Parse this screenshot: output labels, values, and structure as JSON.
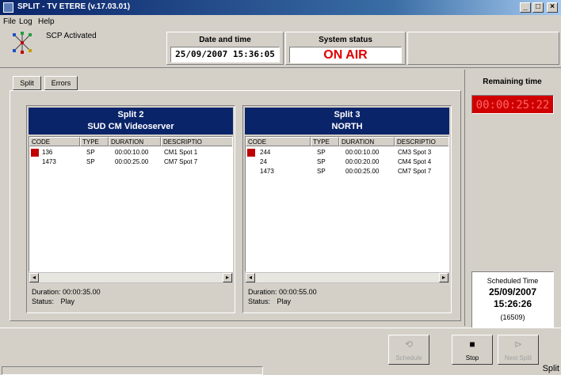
{
  "window": {
    "title": "SPLIT - TV ETERE (v.17.03.01)",
    "minimize": "_",
    "maximize": "□",
    "close": "×"
  },
  "menu": [
    "File",
    "Log",
    "Help"
  ],
  "header": {
    "scp_label": "SCP Activated",
    "datetime_label": "Date and time",
    "datetime_value": "25/09/2007   15:36:05",
    "status_label": "System status",
    "status_value": "ON AIR"
  },
  "tabs": [
    "Split",
    "Errors"
  ],
  "columns": [
    "CODE",
    "TYPE",
    "DURATION",
    "DESCRIPTIO"
  ],
  "splits": [
    {
      "title": "Split 2",
      "subtitle": "SUD CM Videoserver",
      "rows": [
        {
          "code": "136",
          "type": "SP",
          "duration": "00:00:10.00",
          "description": "CM1 Spot 1"
        },
        {
          "code": "1473",
          "type": "SP",
          "duration": "00:00:25.00",
          "description": "CM7 Spot 7"
        }
      ],
      "duration_label": "Duration:",
      "duration_value": "00:00:35.00",
      "status_label": "Status:",
      "status_value": "Play"
    },
    {
      "title": "Split 3",
      "subtitle": "NORTH",
      "rows": [
        {
          "code": "244",
          "type": "SP",
          "duration": "00:00:10.00",
          "description": "CM3 Spot 3"
        },
        {
          "code": "24",
          "type": "SP",
          "duration": "00:00:20.00",
          "description": "CM4 Spot 4"
        },
        {
          "code": "1473",
          "type": "SP",
          "duration": "00:00:25.00",
          "description": "CM7 Spot 7"
        }
      ],
      "duration_label": "Duration:",
      "duration_value": "00:00:55.00",
      "status_label": "Status:",
      "status_value": "Play"
    }
  ],
  "remaining": {
    "label": "Remaining time",
    "value": "00:00:25:22"
  },
  "scheduled": {
    "label": "Scheduled Time",
    "date": "25/09/2007",
    "time": "15:26:26",
    "id": "(16509)"
  },
  "toolbar": {
    "btn1": "Schedule",
    "stop": "Stop",
    "btn3": "Next Split"
  },
  "statusbar": {
    "right_text": "Split"
  },
  "colors": {
    "accent": "#0a246a",
    "on_air": "#e00000",
    "remaining_bg": "#d00000"
  }
}
